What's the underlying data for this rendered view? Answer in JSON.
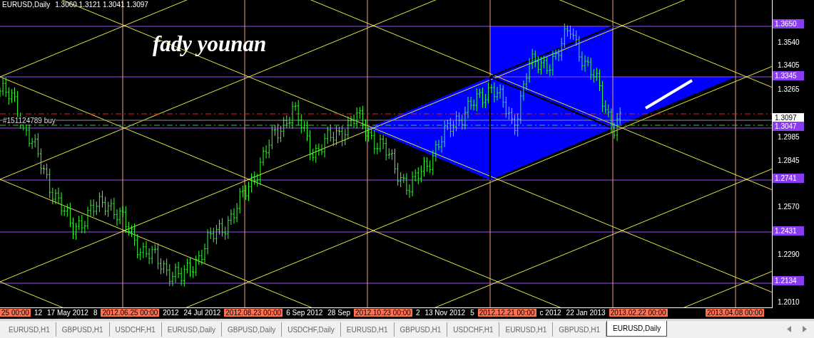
{
  "chart_header": {
    "symbol": "EURUSD,Daily",
    "ohlc": "1.3060 1.3121 1.3041 1.3097"
  },
  "chart_label": "fady younan",
  "order_label": "#151124789 buy",
  "price_axis": {
    "ticks": [
      "1.3540",
      "1.3405",
      "1.3265",
      "1.2985",
      "1.2845",
      "1.2570",
      "1.2290",
      "1.2010"
    ],
    "level_badges": [
      {
        "label": "1.3650",
        "kind": "level"
      },
      {
        "label": "1.3345",
        "kind": "level"
      },
      {
        "label": "1.3097",
        "kind": "price"
      },
      {
        "label": "1.3047",
        "kind": "level"
      },
      {
        "label": "1.2741",
        "kind": "level"
      },
      {
        "label": "1.2431",
        "kind": "level"
      },
      {
        "label": "1.2134",
        "kind": "level"
      }
    ]
  },
  "time_axis": [
    {
      "label": "25 00:00",
      "kind": "marker"
    },
    {
      "label": "12",
      "kind": "date"
    },
    {
      "label": "17 May 2012",
      "kind": "date"
    },
    {
      "label": "8",
      "kind": "date"
    },
    {
      "label": "2012.06.25 00:00",
      "kind": "marker"
    },
    {
      "label": "2012",
      "kind": "date"
    },
    {
      "label": "24 Jul 2012",
      "kind": "date"
    },
    {
      "label": "2012.08.23 00:00",
      "kind": "marker"
    },
    {
      "label": "6 Sep 2012",
      "kind": "date"
    },
    {
      "label": "28 Sep",
      "kind": "date"
    },
    {
      "label": "2012.10.23 00:00",
      "kind": "marker"
    },
    {
      "label": "2",
      "kind": "date"
    },
    {
      "label": "13 Nov 2012",
      "kind": "date"
    },
    {
      "label": "5",
      "kind": "date"
    },
    {
      "label": "2012.12.21 00:00",
      "kind": "marker"
    },
    {
      "label": "c 2012",
      "kind": "date"
    },
    {
      "label": "22 Jan 2013",
      "kind": "date"
    },
    {
      "label": "2013.02.22 00:00",
      "kind": "marker"
    },
    {
      "label": "2013.04.08 00:00",
      "kind": "marker"
    }
  ],
  "tabs": [
    {
      "label": "EURUSD,H1",
      "selected": false
    },
    {
      "label": "GBPUSD,H1",
      "selected": false
    },
    {
      "label": "USDCHF,H1",
      "selected": false
    },
    {
      "label": "EURUSD,Daily",
      "selected": false
    },
    {
      "label": "GBPUSD,Daily",
      "selected": false
    },
    {
      "label": "USDCHF,Daily",
      "selected": false
    },
    {
      "label": "EURUSD,H1",
      "selected": false
    },
    {
      "label": "GBPUSD,H1",
      "selected": false
    },
    {
      "label": "USDCHF,H1",
      "selected": false
    },
    {
      "label": "EURUSD,H1",
      "selected": false
    },
    {
      "label": "GBPUSD,H1",
      "selected": false
    },
    {
      "label": "EURUSD,Daily",
      "selected": true
    }
  ]
}
